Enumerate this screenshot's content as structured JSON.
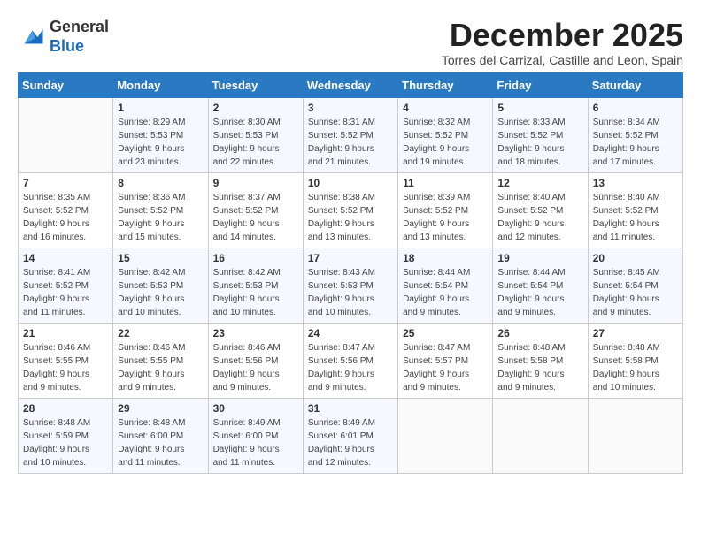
{
  "header": {
    "logo_line1": "General",
    "logo_line2": "Blue",
    "month_title": "December 2025",
    "subtitle": "Torres del Carrizal, Castille and Leon, Spain"
  },
  "calendar": {
    "days_of_week": [
      "Sunday",
      "Monday",
      "Tuesday",
      "Wednesday",
      "Thursday",
      "Friday",
      "Saturday"
    ],
    "weeks": [
      [
        {
          "day": "",
          "info": ""
        },
        {
          "day": "1",
          "info": "Sunrise: 8:29 AM\nSunset: 5:53 PM\nDaylight: 9 hours\nand 23 minutes."
        },
        {
          "day": "2",
          "info": "Sunrise: 8:30 AM\nSunset: 5:53 PM\nDaylight: 9 hours\nand 22 minutes."
        },
        {
          "day": "3",
          "info": "Sunrise: 8:31 AM\nSunset: 5:52 PM\nDaylight: 9 hours\nand 21 minutes."
        },
        {
          "day": "4",
          "info": "Sunrise: 8:32 AM\nSunset: 5:52 PM\nDaylight: 9 hours\nand 19 minutes."
        },
        {
          "day": "5",
          "info": "Sunrise: 8:33 AM\nSunset: 5:52 PM\nDaylight: 9 hours\nand 18 minutes."
        },
        {
          "day": "6",
          "info": "Sunrise: 8:34 AM\nSunset: 5:52 PM\nDaylight: 9 hours\nand 17 minutes."
        }
      ],
      [
        {
          "day": "7",
          "info": "Sunrise: 8:35 AM\nSunset: 5:52 PM\nDaylight: 9 hours\nand 16 minutes."
        },
        {
          "day": "8",
          "info": "Sunrise: 8:36 AM\nSunset: 5:52 PM\nDaylight: 9 hours\nand 15 minutes."
        },
        {
          "day": "9",
          "info": "Sunrise: 8:37 AM\nSunset: 5:52 PM\nDaylight: 9 hours\nand 14 minutes."
        },
        {
          "day": "10",
          "info": "Sunrise: 8:38 AM\nSunset: 5:52 PM\nDaylight: 9 hours\nand 13 minutes."
        },
        {
          "day": "11",
          "info": "Sunrise: 8:39 AM\nSunset: 5:52 PM\nDaylight: 9 hours\nand 13 minutes."
        },
        {
          "day": "12",
          "info": "Sunrise: 8:40 AM\nSunset: 5:52 PM\nDaylight: 9 hours\nand 12 minutes."
        },
        {
          "day": "13",
          "info": "Sunrise: 8:40 AM\nSunset: 5:52 PM\nDaylight: 9 hours\nand 11 minutes."
        }
      ],
      [
        {
          "day": "14",
          "info": "Sunrise: 8:41 AM\nSunset: 5:52 PM\nDaylight: 9 hours\nand 11 minutes."
        },
        {
          "day": "15",
          "info": "Sunrise: 8:42 AM\nSunset: 5:53 PM\nDaylight: 9 hours\nand 10 minutes."
        },
        {
          "day": "16",
          "info": "Sunrise: 8:42 AM\nSunset: 5:53 PM\nDaylight: 9 hours\nand 10 minutes."
        },
        {
          "day": "17",
          "info": "Sunrise: 8:43 AM\nSunset: 5:53 PM\nDaylight: 9 hours\nand 10 minutes."
        },
        {
          "day": "18",
          "info": "Sunrise: 8:44 AM\nSunset: 5:54 PM\nDaylight: 9 hours\nand 9 minutes."
        },
        {
          "day": "19",
          "info": "Sunrise: 8:44 AM\nSunset: 5:54 PM\nDaylight: 9 hours\nand 9 minutes."
        },
        {
          "day": "20",
          "info": "Sunrise: 8:45 AM\nSunset: 5:54 PM\nDaylight: 9 hours\nand 9 minutes."
        }
      ],
      [
        {
          "day": "21",
          "info": "Sunrise: 8:46 AM\nSunset: 5:55 PM\nDaylight: 9 hours\nand 9 minutes."
        },
        {
          "day": "22",
          "info": "Sunrise: 8:46 AM\nSunset: 5:55 PM\nDaylight: 9 hours\nand 9 minutes."
        },
        {
          "day": "23",
          "info": "Sunrise: 8:46 AM\nSunset: 5:56 PM\nDaylight: 9 hours\nand 9 minutes."
        },
        {
          "day": "24",
          "info": "Sunrise: 8:47 AM\nSunset: 5:56 PM\nDaylight: 9 hours\nand 9 minutes."
        },
        {
          "day": "25",
          "info": "Sunrise: 8:47 AM\nSunset: 5:57 PM\nDaylight: 9 hours\nand 9 minutes."
        },
        {
          "day": "26",
          "info": "Sunrise: 8:48 AM\nSunset: 5:58 PM\nDaylight: 9 hours\nand 9 minutes."
        },
        {
          "day": "27",
          "info": "Sunrise: 8:48 AM\nSunset: 5:58 PM\nDaylight: 9 hours\nand 10 minutes."
        }
      ],
      [
        {
          "day": "28",
          "info": "Sunrise: 8:48 AM\nSunset: 5:59 PM\nDaylight: 9 hours\nand 10 minutes."
        },
        {
          "day": "29",
          "info": "Sunrise: 8:48 AM\nSunset: 6:00 PM\nDaylight: 9 hours\nand 11 minutes."
        },
        {
          "day": "30",
          "info": "Sunrise: 8:49 AM\nSunset: 6:00 PM\nDaylight: 9 hours\nand 11 minutes."
        },
        {
          "day": "31",
          "info": "Sunrise: 8:49 AM\nSunset: 6:01 PM\nDaylight: 9 hours\nand 12 minutes."
        },
        {
          "day": "",
          "info": ""
        },
        {
          "day": "",
          "info": ""
        },
        {
          "day": "",
          "info": ""
        }
      ]
    ]
  }
}
